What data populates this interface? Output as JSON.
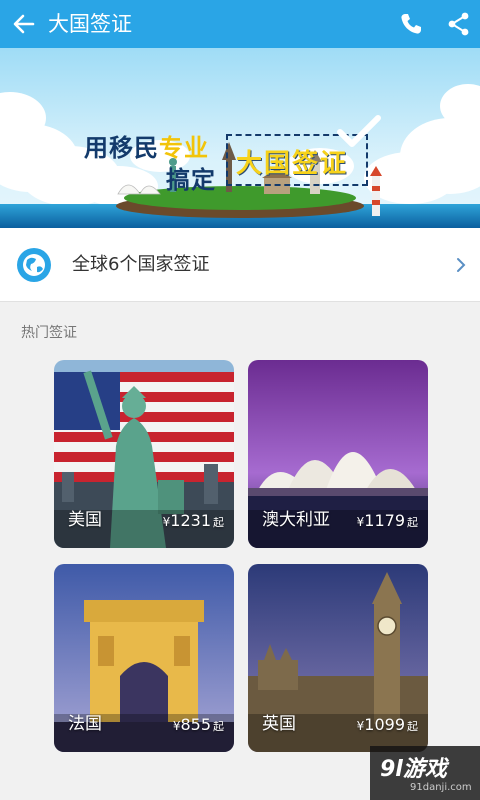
{
  "header": {
    "title": "大国签证",
    "back_icon": "arrow-left-icon",
    "actions": [
      "phone-icon",
      "share-icon"
    ],
    "background": "#2aa5e6"
  },
  "banner": {
    "slogan_line1_prefix": "用移民",
    "slogan_line1_highlight": "专业",
    "slogan_line2": "搞定",
    "badge_text": "大国签证"
  },
  "summary": {
    "label": "全球6个国家签证",
    "icon": "globe-icon"
  },
  "section": {
    "title": "热门签证"
  },
  "cards": [
    {
      "name": "美国",
      "currency": "¥",
      "price": "1231",
      "suffix": "起"
    },
    {
      "name": "澳大利亚",
      "currency": "¥",
      "price": "1179",
      "suffix": "起"
    },
    {
      "name": "法国",
      "currency": "¥",
      "price": "855",
      "suffix": "起"
    },
    {
      "name": "英国",
      "currency": "¥",
      "price": "1099",
      "suffix": "起"
    }
  ],
  "watermark": {
    "logo": "9l游戏",
    "url": "91danji.com"
  }
}
